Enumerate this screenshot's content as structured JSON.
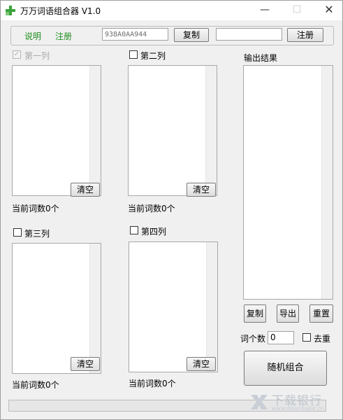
{
  "window": {
    "title": "万万词语组合器 V1.0",
    "minimize_glyph": "—",
    "maximize_glyph": "☐",
    "close_glyph": "✕"
  },
  "toolbar": {
    "help_link": "说明",
    "register_link": "注册",
    "machine_code": "938A0AA944",
    "copy_button": "复制",
    "reg_code_value": "",
    "register_button": "注册"
  },
  "columns": [
    {
      "label": "第一列",
      "checked": true,
      "disabled": true,
      "clear_button": "清空",
      "count_text": "当前词数0个"
    },
    {
      "label": "第二列",
      "checked": false,
      "disabled": false,
      "clear_button": "清空",
      "count_text": "当前词数0个"
    },
    {
      "label": "第三列",
      "checked": false,
      "disabled": false,
      "clear_button": "清空",
      "count_text": "当前词数0个"
    },
    {
      "label": "第四列",
      "checked": false,
      "disabled": false,
      "clear_button": "清空",
      "count_text": "当前词数0个"
    }
  ],
  "output": {
    "label": "输出结果",
    "copy_button": "复制",
    "export_button": "导出",
    "reset_button": "重置",
    "word_count_label": "词个数",
    "word_count_value": "0",
    "dedupe_label": "去重",
    "combine_button": "随机组合"
  },
  "watermark": {
    "text": "下载银行",
    "sub": "www.downbank.cn"
  },
  "colors": {
    "link_green": "#1f8f1f",
    "icon_green": "#3aa33a"
  }
}
